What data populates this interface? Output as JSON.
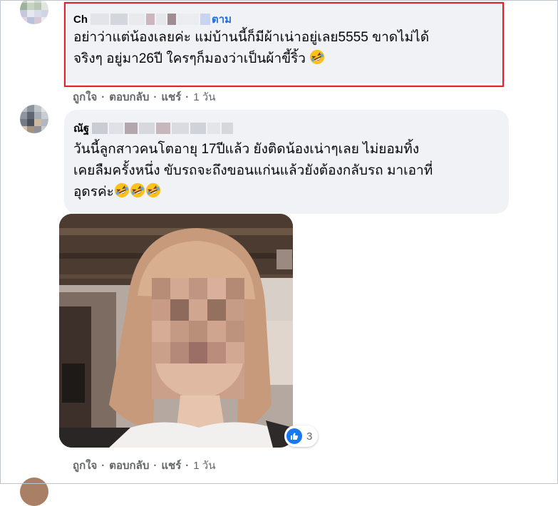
{
  "comments": [
    {
      "name": "Ch",
      "follow_label": "ตาม",
      "lines": [
        "อย่าว่าแต่น้องเลยค่ะ แม่บ้านนี้ก็มีผ้าเน่าอยู่เลย5555 ขาดไม่ได้",
        "จริงๆ อยู่มา26ปี ใครๆก็มองว่าเป็นผ้าขี้ริ้ว"
      ],
      "emoji": "rolling-on-floor-laughing",
      "actions": {
        "like": "ถูกใจ",
        "reply": "ตอบกลับ",
        "share": "แชร์",
        "time": "1 วัน"
      }
    },
    {
      "name": "ณัฐ",
      "lines": [
        "วันนี้ลูกสาวคนโตอายุ 17ปีแล้ว ยังติดน้องเน่าๆเลย ไม่ยอมทิ้ง",
        "เคยลืมครั้งหนึ่ง ขับรถจะถึงขอนแก่นแล้วยังต้องกลับรถ มาเอาที่",
        "อุดรค่ะ"
      ],
      "emoji": "rolling-on-floor-laughing",
      "photo": "blurred-selfie-photo",
      "reaction": {
        "icon": "like-icon",
        "count": "3"
      },
      "actions": {
        "like": "ถูกใจ",
        "reply": "ตอบกลับ",
        "share": "แชร์",
        "time": "1 วัน"
      }
    }
  ],
  "separator": "·",
  "colors": {
    "highlight": "#e0212b",
    "bubble": "#f0f2f5",
    "link": "#216fdb",
    "meta": "#65676b",
    "like": "#1877f2"
  }
}
